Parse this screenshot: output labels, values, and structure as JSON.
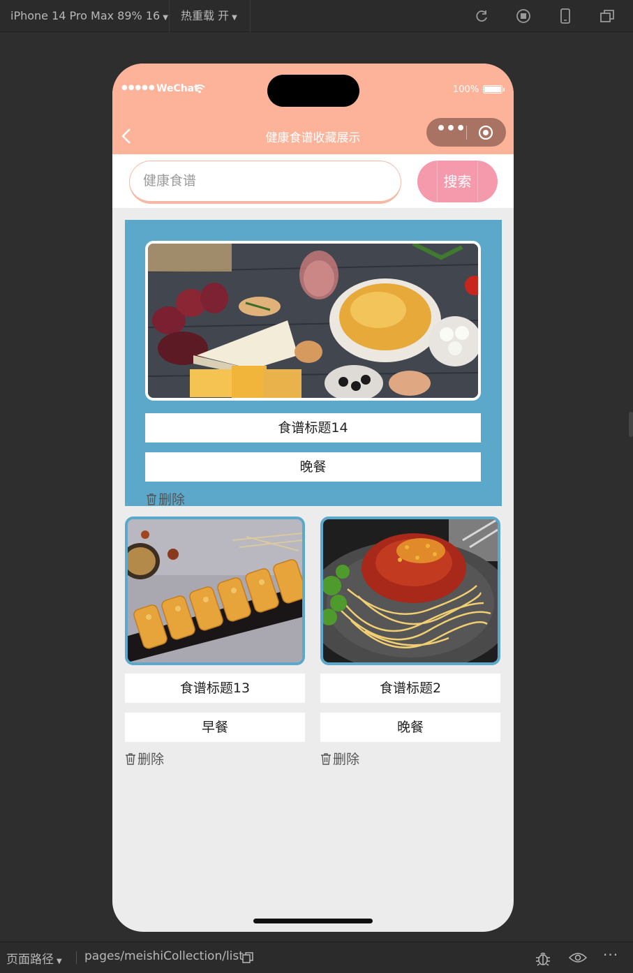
{
  "devtools": {
    "device": "iPhone 14 Pro Max 89% 16",
    "hot_reload": "热重载 开",
    "path_label": "页面路径",
    "path_value": "pages/meishiCollection/list"
  },
  "statusbar": {
    "signal": "●●●●●",
    "carrier": "WeChat",
    "battery": "100%"
  },
  "navbar": {
    "title": "健康食谱收藏展示"
  },
  "search": {
    "placeholder": "健康食谱",
    "button": "搜索"
  },
  "colors": {
    "header": "#fdb39a",
    "card_accent": "#5ba8cb",
    "search_button": "#f49aac"
  },
  "delete_label": "删除",
  "recipes": [
    {
      "title": "食谱标题14",
      "category": "晚餐",
      "image": "charcuterie-board-photo"
    },
    {
      "title": "食谱标题13",
      "category": "早餐",
      "image": "fried-rolls-photo"
    },
    {
      "title": "食谱标题2",
      "category": "晚餐",
      "image": "spaghetti-bolognese-photo"
    }
  ]
}
